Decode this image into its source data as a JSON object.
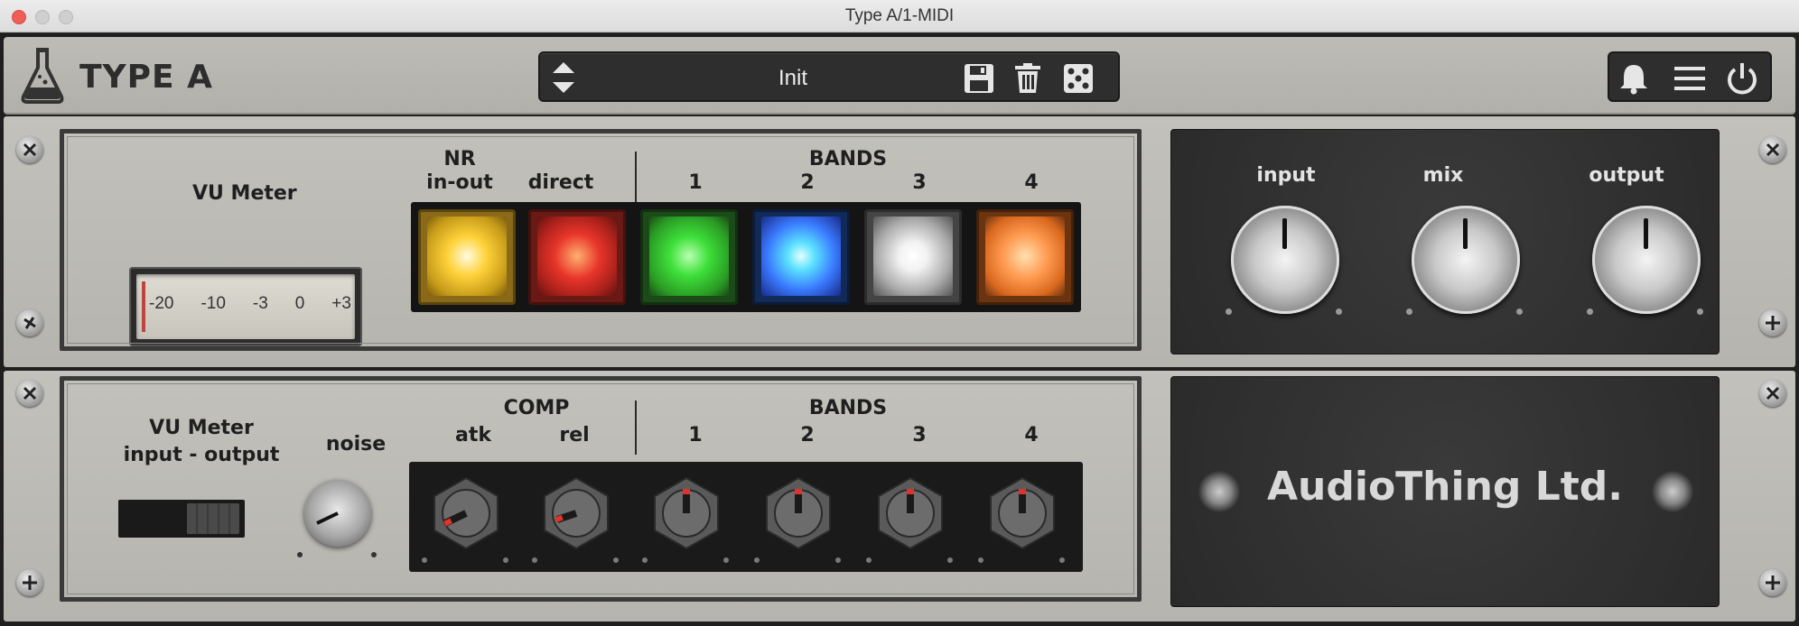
{
  "window": {
    "title": "Type A/1-MIDI"
  },
  "header": {
    "brand": "TYPE A",
    "preset_name": "Init",
    "icons": [
      "up-down-arrows-icon",
      "save-icon",
      "trash-icon",
      "dice-icon",
      "bell-icon",
      "menu-icon",
      "power-icon"
    ]
  },
  "row1": {
    "vu_label": "VU Meter",
    "vu_scale": [
      "-20",
      "-10",
      "-3",
      "0",
      "+3"
    ],
    "nr_label_line1": "NR",
    "nr_label_line2": "in-out",
    "direct_label": "direct",
    "bands_label": "BANDS",
    "band_numbers": [
      "1",
      "2",
      "3",
      "4"
    ],
    "button_colors": {
      "nr": "#ffd23a",
      "direct": "#e8352a",
      "band1": "#3ee03a",
      "band2": "#3aa8ff",
      "band3": "#f2f2f2",
      "band4": "#ff8a30"
    },
    "knob_labels": {
      "input": "input",
      "mix": "mix",
      "output": "output"
    }
  },
  "row2": {
    "vu_label_line1": "VU Meter",
    "vu_label_line2": "input - output",
    "noise_label": "noise",
    "comp_label": "COMP",
    "atk_label": "atk",
    "rel_label": "rel",
    "bands_label": "BANDS",
    "band_numbers": [
      "1",
      "2",
      "3",
      "4"
    ],
    "company": "AudioThing Ltd."
  }
}
